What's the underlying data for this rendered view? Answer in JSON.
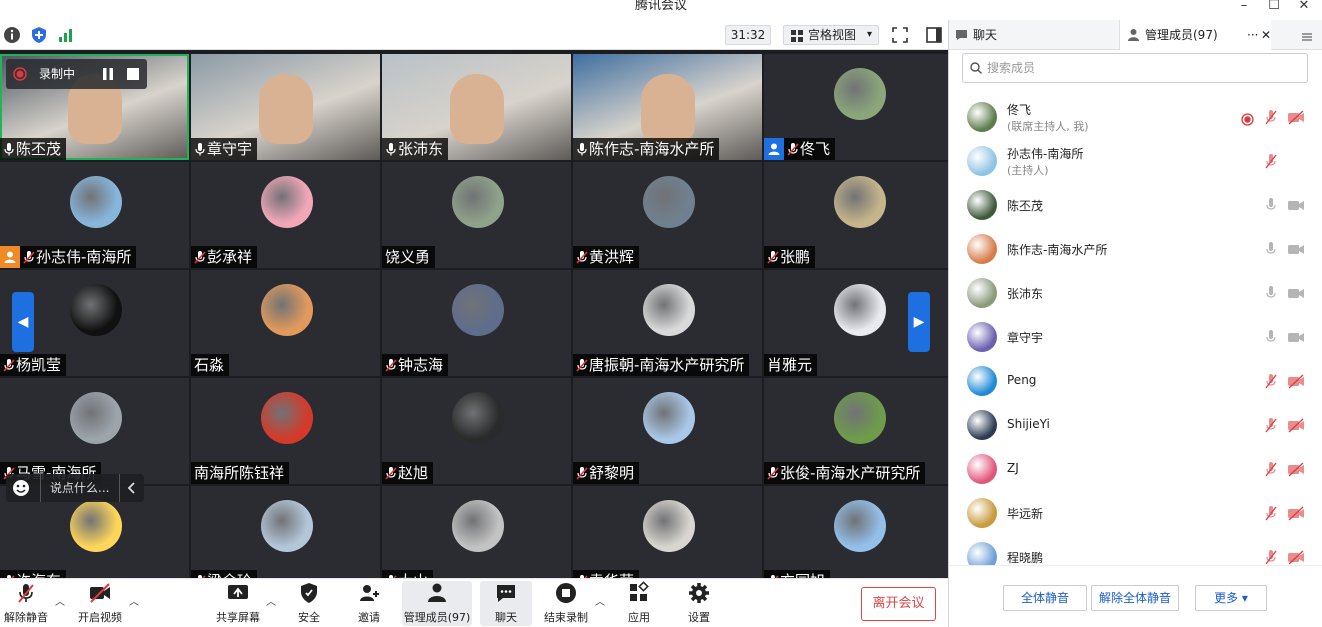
{
  "window": {
    "title": "腾讯会议",
    "min": "–",
    "max": "☐",
    "close": "✕"
  },
  "toolbar": {
    "timer": "31:32",
    "view_label": "宫格视图",
    "view_caret": "▾"
  },
  "recording": {
    "label": "录制中"
  },
  "chat_pill": {
    "placeholder": "说点什么..."
  },
  "tiles": [
    {
      "name": "陈丕茂",
      "type": "video"
    },
    {
      "name": "章守宇",
      "type": "video"
    },
    {
      "name": "张沛东",
      "type": "video"
    },
    {
      "name": "陈作志-南海水产所",
      "type": "video"
    },
    {
      "name": "佟飞",
      "type": "avatar"
    },
    {
      "name": "孙志伟-南海所",
      "type": "avatar"
    },
    {
      "name": "彭承祥",
      "type": "avatar"
    },
    {
      "name": "饶义勇",
      "type": "avatar"
    },
    {
      "name": "黄洪辉",
      "type": "avatar"
    },
    {
      "name": "张鹏",
      "type": "avatar"
    },
    {
      "name": "杨凯莹",
      "type": "avatar"
    },
    {
      "name": "石淼",
      "type": "avatar"
    },
    {
      "name": "钟志海",
      "type": "avatar"
    },
    {
      "name": "唐振朝-南海水产研究所",
      "type": "avatar"
    },
    {
      "name": "肖雅元",
      "type": "avatar"
    },
    {
      "name": "马雪-南海所",
      "type": "avatar"
    },
    {
      "name": "南海所陈钰祥",
      "type": "avatar"
    },
    {
      "name": "赵旭",
      "type": "avatar"
    },
    {
      "name": "舒黎明",
      "type": "avatar"
    },
    {
      "name": "张俊-南海水产研究所",
      "type": "avatar"
    },
    {
      "name": "许海东",
      "type": "avatar"
    },
    {
      "name": "梁余玲",
      "type": "avatar"
    },
    {
      "name": "大山",
      "type": "avatar"
    },
    {
      "name": "袁华荣",
      "type": "avatar"
    },
    {
      "name": "方园旭",
      "type": "avatar"
    }
  ],
  "bottombar": {
    "unmute": "解除静音",
    "video": "开启视频",
    "share": "共享屏幕",
    "security": "安全",
    "invite": "邀请",
    "members": "管理成员(97)",
    "chat": "聊天",
    "end_record": "结束录制",
    "apps": "应用",
    "settings": "设置",
    "leave": "离开会议"
  },
  "panel": {
    "tab_chat": "聊天",
    "tab_members": "管理成员(97)",
    "more": "···",
    "close": "✕",
    "search_placeholder": "搜索成员",
    "members": [
      {
        "name": "佟飞",
        "sub": "(联席主持人, 我)"
      },
      {
        "name": "孙志伟-南海所",
        "sub": "(主持人)"
      },
      {
        "name": "陈丕茂",
        "sub": ""
      },
      {
        "name": "陈作志-南海水产所",
        "sub": ""
      },
      {
        "name": "张沛东",
        "sub": ""
      },
      {
        "name": "章守宇",
        "sub": ""
      },
      {
        "name": "Peng",
        "sub": ""
      },
      {
        "name": "ShijieYi",
        "sub": ""
      },
      {
        "name": "ZJ",
        "sub": ""
      },
      {
        "name": "毕远新",
        "sub": ""
      },
      {
        "name": "程晓鹏",
        "sub": ""
      }
    ],
    "mute_all": "全体静音",
    "unmute_all": "解除全体静音",
    "more_btn": "更多 ▾"
  },
  "colors": {
    "accent": "#1e6fe0",
    "leave": "#e14646",
    "active_border": "#21b359",
    "record": "#e0383e"
  }
}
